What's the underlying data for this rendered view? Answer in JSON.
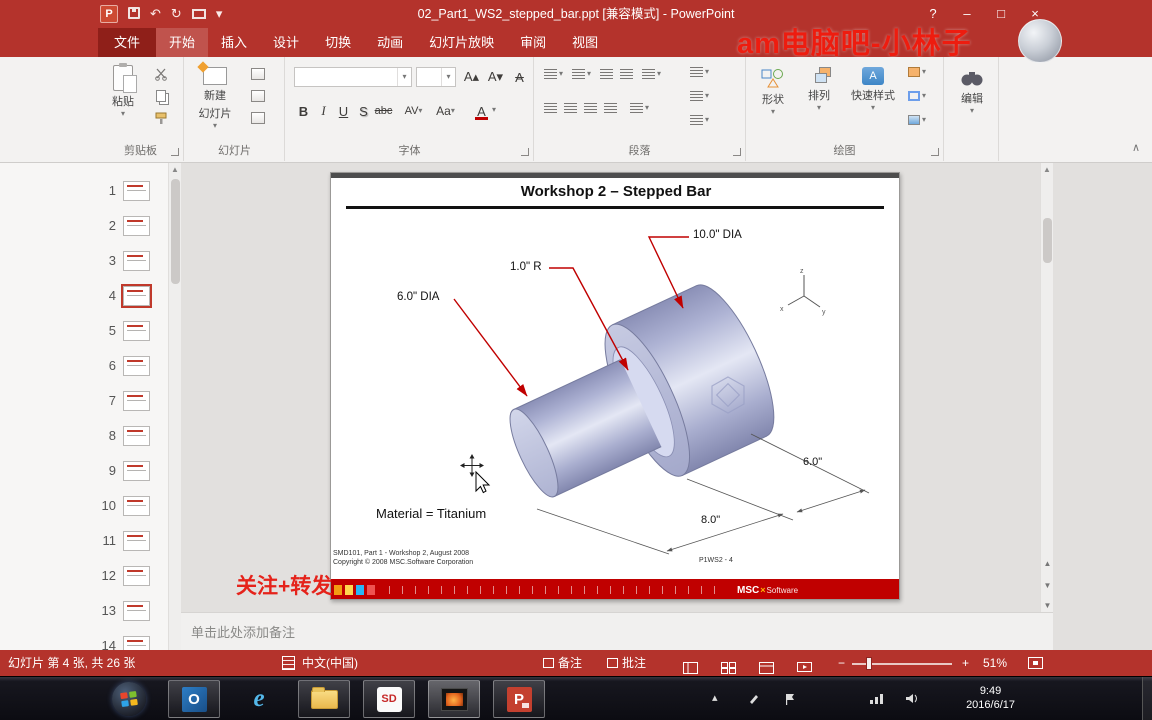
{
  "titlebar": {
    "title": "02_Part1_WS2_stepped_bar.ppt [兼容模式] - PowerPoint",
    "watermark": "am电脑吧-小林子",
    "app_letter": "P",
    "help_label": "?",
    "minimize_label": "–",
    "restore_label": "□",
    "close_label": "×"
  },
  "icons": {
    "dropdown": "▾",
    "undo": "↶",
    "redo": "↻",
    "collapse": "∧",
    "scroll_up": "▲",
    "scroll_down": "▼",
    "tray_up": "▴",
    "prev_slide": "▲",
    "next_slide": "▼",
    "grow_font": "A▴",
    "shrink_font": "A▾",
    "clear_format": "A"
  },
  "tabs": {
    "file": "文件",
    "items": [
      "开始",
      "插入",
      "设计",
      "切换",
      "动画",
      "幻灯片放映",
      "审阅",
      "视图"
    ]
  },
  "ribbon": {
    "clipboard": {
      "group": "剪贴板",
      "paste": "粘贴"
    },
    "slides": {
      "group": "幻灯片",
      "new_slide_line1": "新建",
      "new_slide_line2": "幻灯片"
    },
    "font": {
      "group": "字体",
      "bold": "B",
      "italic": "I",
      "underline": "U",
      "shadow": "S",
      "strike": "abc",
      "spacing": "AV",
      "case": "Aa",
      "color": "A"
    },
    "paragraph": {
      "group": "段落"
    },
    "drawing": {
      "group": "绘图",
      "shapes": "形状",
      "arrange": "排列",
      "quick_styles": "快速样式",
      "qs_letter": "A"
    },
    "editing": {
      "label": "编辑"
    }
  },
  "slide_panel": {
    "numbers": [
      "1",
      "2",
      "3",
      "4",
      "5",
      "6",
      "7",
      "8",
      "9",
      "10",
      "11",
      "12",
      "13",
      "14"
    ],
    "selected": "4"
  },
  "slide": {
    "title": "Workshop 2 – Stepped Bar",
    "ann_dia10": "10.0\" DIA",
    "ann_r1": "1.0\" R",
    "ann_dia6": "6.0\" DIA",
    "dim_6": "6.0\"",
    "dim_8": "8.0\"",
    "material": "Material = Titanium",
    "footer_line1": "SMD101, Part 1 - Workshop 2, August 2008",
    "footer_line2": "Copyright © 2008 MSC.Software Corporation",
    "slide_number": "P1WS2 - 4",
    "axis_x": "x",
    "axis_y": "y",
    "axis_z": "z",
    "banner": {
      "msc": "MSC",
      "x": "×",
      "software": "Software"
    }
  },
  "overlay_text": "关注+转发",
  "notes": {
    "placeholder": "单击此处添加备注"
  },
  "statusbar": {
    "slide_info": "幻灯片 第 4 张, 共 26 张",
    "language": "中文(中国)",
    "notes": "备注",
    "comments": "批注",
    "zoom_out": "−",
    "zoom_in": "+",
    "zoom_level": "51%"
  },
  "taskbar": {
    "outlook_label": "O",
    "ie_label": "e",
    "sd_label": "SD",
    "ppt_label": "P",
    "time": "9:49",
    "date": "2016/6/17"
  }
}
